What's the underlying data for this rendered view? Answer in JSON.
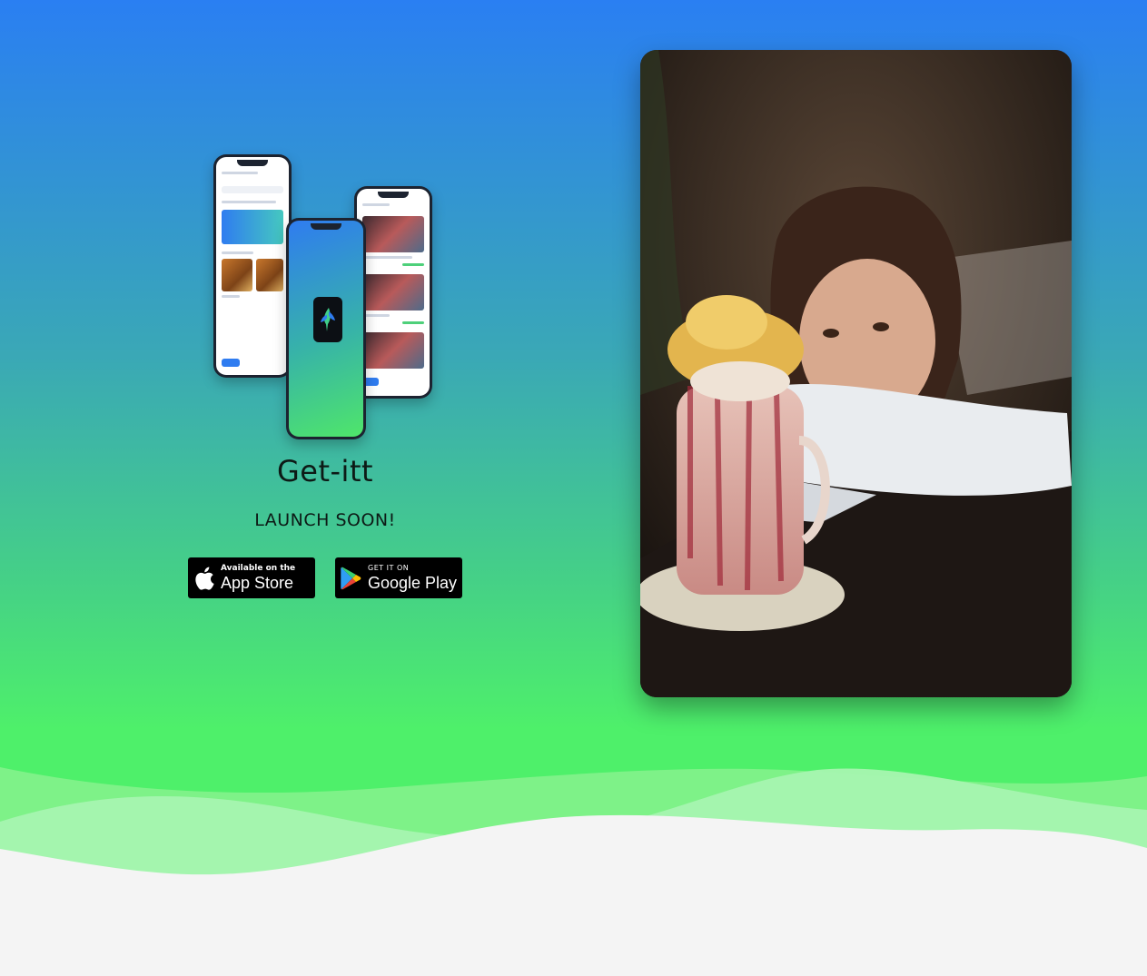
{
  "brand": {
    "name": "Get-itt",
    "tagline": "LAUNCH SOON!"
  },
  "stores": {
    "apple": {
      "small": "Available on the",
      "big": "App Store"
    },
    "google": {
      "small": "GET IT ON",
      "big": "Google Play"
    }
  },
  "colors": {
    "gradient_top": "#2a7ff2",
    "gradient_bottom": "#4ef06a",
    "page_bg": "#f4f4f4"
  },
  "icons": [
    "apple-logo-icon",
    "google-play-icon",
    "hummingbird-icon"
  ]
}
